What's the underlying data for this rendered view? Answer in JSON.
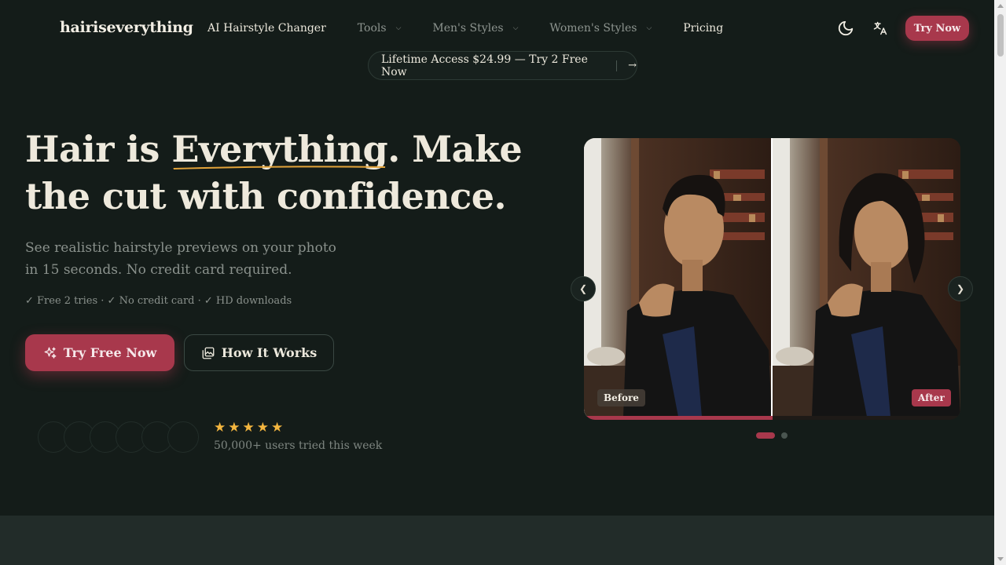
{
  "header": {
    "logo": "hairiseverything",
    "nav": [
      {
        "label": "AI Hairstyle Changer",
        "dropdown": false
      },
      {
        "label": "Tools",
        "dropdown": true
      },
      {
        "label": "Men's Styles",
        "dropdown": true
      },
      {
        "label": "Women's Styles",
        "dropdown": true
      },
      {
        "label": "Pricing",
        "dropdown": false
      }
    ],
    "icons": [
      "moon-icon",
      "translate-icon"
    ],
    "cta_label": "Try Now"
  },
  "promo": {
    "text": "Lifetime Access $24.99 — Try 2 Free Now",
    "arrow_icon": "arrow-right-icon"
  },
  "hero": {
    "title_part1": "Hair is ",
    "title_highlight": "Everything",
    "title_part2": ". Make the cut with confidence.",
    "subtitle": "See realistic hairstyle previews on your photo in 15 seconds. No credit card required.",
    "checks": "✓ Free 2 tries · ✓ No credit card · ✓ HD downloads",
    "primary_button": "Try Free Now",
    "secondary_button": "How It Works",
    "rating_stars": 5,
    "social_proof": "50,000+ users tried this week"
  },
  "slider": {
    "before_label": "Before",
    "after_label": "After",
    "slide_count": 2,
    "active_slide": 1
  },
  "colors": {
    "background": "#141c19",
    "accent": "#a8384c",
    "star": "#f4b63f",
    "highlight_underline": "#e2a33a"
  }
}
